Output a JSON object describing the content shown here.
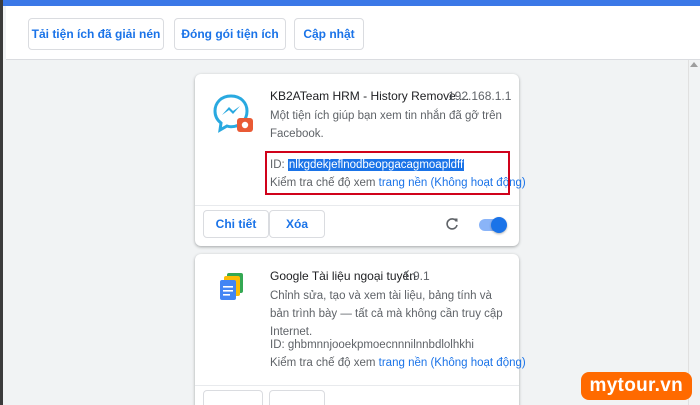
{
  "toolbar": {
    "load_unpacked": "Tải tiện ích đã giải nén",
    "pack": "Đóng gói tiện ích",
    "update": "Cập nhật"
  },
  "extensions": [
    {
      "name": "KB2ATeam HRM - History Remove ...",
      "version": "192.168.1.1",
      "description": "Một tiện ích giúp bạn xem tin nhắn đã gỡ trên Facebook.",
      "id_label": "ID: ",
      "id_value": "nlkgdekjeflnodbeopgacagmoapldff",
      "inspect_label": "Kiểm tra chế độ xem ",
      "inspect_link": "trang nền (Không hoạt động)",
      "details_label": "Chi tiết",
      "remove_label": "Xóa",
      "icon": "messenger-icon",
      "enabled": true
    },
    {
      "name": "Google Tài liệu ngoại tuyến",
      "version": "1.9.1",
      "description": "Chỉnh sửa, tạo và xem tài liệu, bảng tính và bản trình bày — tất cả mà không cần truy cập Internet.",
      "id_label": "ID: ",
      "id_value": "ghbmnnjooekpmoecnnnilnnbdlolhkhi",
      "inspect_label": "Kiểm tra chế độ xem ",
      "inspect_link": "trang nền (Không hoạt động)",
      "icon": "google-docs-icon",
      "enabled": true
    }
  ],
  "watermark": "mytour.vn",
  "colors": {
    "accent": "#1a73e8",
    "highlight_box": "#d0021b",
    "watermark_bg": "#ff6a00"
  }
}
